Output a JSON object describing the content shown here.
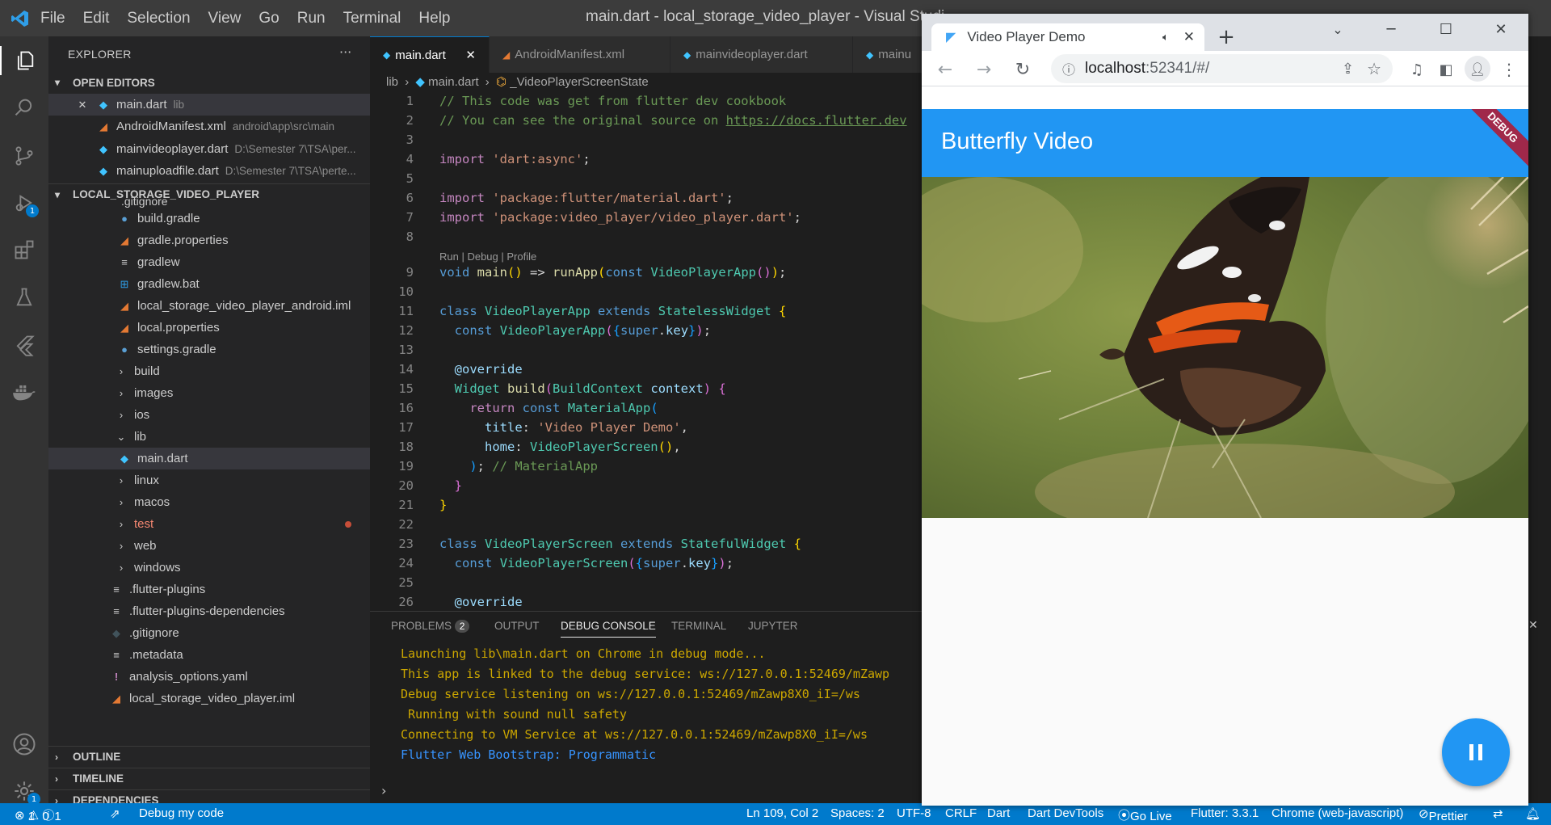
{
  "titlebar": {
    "menu": [
      "File",
      "Edit",
      "Selection",
      "View",
      "Go",
      "Run",
      "Terminal",
      "Help"
    ],
    "window_title": "main.dart - local_storage_video_player - Visual Studi"
  },
  "activity": {
    "debug_badge": "1",
    "settings_badge": "1"
  },
  "sidebar": {
    "header": "EXPLORER",
    "more": "···",
    "open_editors_label": "OPEN EDITORS",
    "open_editors": [
      {
        "name": "main.dart",
        "desc": "lib"
      },
      {
        "name": "AndroidManifest.xml",
        "desc": "android\\app\\src\\main"
      },
      {
        "name": "mainvideoplayer.dart",
        "desc": "D:\\Semester 7\\TSA\\per..."
      },
      {
        "name": "mainuploadfile.dart",
        "desc": "D:\\Semester 7\\TSA\\perte..."
      }
    ],
    "project_label": "LOCAL_STORAGE_VIDEO_PLAYER",
    "tree": [
      ".gitignore",
      "build.gradle",
      "gradle.properties",
      "gradlew",
      "gradlew.bat",
      "local_storage_video_player_android.iml",
      "local.properties",
      "settings.gradle",
      "build",
      "images",
      "ios",
      "lib",
      "main.dart",
      "linux",
      "macos",
      "test",
      "web",
      "windows",
      ".flutter-plugins",
      ".flutter-plugins-dependencies",
      ".gitignore",
      ".metadata",
      "analysis_options.yaml",
      "local_storage_video_player.iml"
    ],
    "outline": "OUTLINE",
    "timeline": "TIMELINE",
    "dependencies": "DEPENDENCIES"
  },
  "editor": {
    "tabs": [
      "main.dart",
      "AndroidManifest.xml",
      "mainvideoplayer.dart",
      "mainu"
    ],
    "breadcrumb": {
      "a": "lib",
      "b": "main.dart",
      "c": "_VideoPlayerScreenState"
    },
    "codelens": "Run | Debug | Profile",
    "line_numbers": [
      "1",
      "2",
      "3",
      "4",
      "5",
      "6",
      "7",
      "8",
      "9",
      "10",
      "11",
      "12",
      "13",
      "14",
      "15",
      "16",
      "17",
      "18",
      "19",
      "20",
      "21",
      "22",
      "23",
      "24",
      "25",
      "26"
    ]
  },
  "panel": {
    "tabs": [
      "PROBLEMS",
      "OUTPUT",
      "DEBUG CONSOLE",
      "TERMINAL",
      "JUPYTER"
    ],
    "problems_count": "2",
    "lines": [
      "Launching lib\\main.dart on Chrome in debug mode...",
      "This app is linked to the debug service: ws://127.0.0.1:52469/mZawp",
      "Debug service listening on ws://127.0.0.1:52469/mZawp8X0_iI=/ws",
      " Running with sound null safety",
      "Connecting to VM Service at ws://127.0.0.1:52469/mZawp8X0_iI=/ws",
      "Flutter Web Bootstrap: Programmatic"
    ]
  },
  "status": {
    "errors": "1",
    "warnings": "0",
    "info": "1",
    "debug": "Debug my code",
    "position": "Ln 109, Col 2",
    "spaces": "Spaces: 2",
    "encoding": "UTF-8",
    "eol": "CRLF",
    "language": "Dart",
    "devtools": "Dart DevTools",
    "golive": "Go Live",
    "flutter": "Flutter: 3.3.1",
    "device": "Chrome (web-javascript)",
    "prettier": "Prettier"
  },
  "browser": {
    "tab_title": "Video Player Demo",
    "url_host": "localhost",
    "url_rest": ":52341/#/",
    "app_title": "Butterfly Video",
    "debug_banner": "DEBUG"
  },
  "colors": {
    "accent": "#007acc",
    "flutter_blue": "#2196f3",
    "debug_banner": "#a0284a"
  }
}
